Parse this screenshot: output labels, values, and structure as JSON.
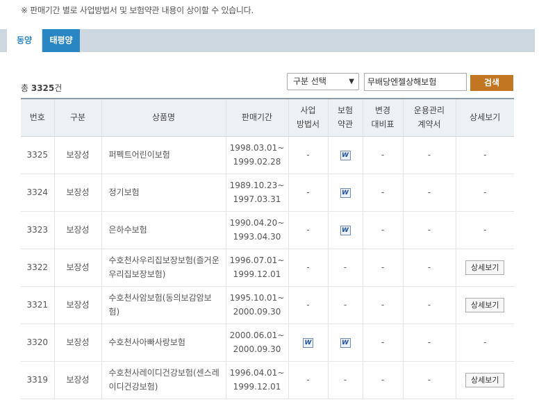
{
  "notice": "※ 판매기간 별로 사업방법서 및 보험약관 내용이 상이할 수 있습니다.",
  "tabs": [
    "동양",
    "태평양"
  ],
  "count": {
    "prefix": "총 ",
    "value": "3325",
    "suffix": "건"
  },
  "filter": {
    "select_value": "구분 선택",
    "search_value": "무배당엔젤상해보험",
    "search_button": "검색"
  },
  "table": {
    "headers": [
      "번호",
      "구분",
      "상품명",
      "판매기간",
      "사업\n방법서",
      "보험\n약관",
      "변경\n대비표",
      "운용관리\n계약서",
      "상세보기"
    ],
    "rows": [
      {
        "no": "3325",
        "type": "보장성",
        "name": "퍼펙트어린이보험",
        "period_from": "1998.03.01~",
        "period_to": "1999.02.28",
        "biz": "-",
        "terms": "W",
        "change": "-",
        "mgmt": "-",
        "detail": "-"
      },
      {
        "no": "3324",
        "type": "보장성",
        "name": "정기보험",
        "period_from": "1989.10.23~",
        "period_to": "1997.03.31",
        "biz": "-",
        "terms": "W",
        "change": "-",
        "mgmt": "-",
        "detail": "-"
      },
      {
        "no": "3323",
        "type": "보장성",
        "name": "은하수보험",
        "period_from": "1990.04.20~",
        "period_to": "1993.04.30",
        "biz": "-",
        "terms": "W",
        "change": "-",
        "mgmt": "-",
        "detail": "-"
      },
      {
        "no": "3322",
        "type": "보장성",
        "name": "수호천사우리집보장보험(즐거운우리집보장보험)",
        "period_from": "1996.07.01~",
        "period_to": "1999.12.01",
        "biz": "-",
        "terms": "-",
        "change": "-",
        "mgmt": "-",
        "detail": "상세보기"
      },
      {
        "no": "3321",
        "type": "보장성",
        "name": "수호천사암보험(동의보감암보험)",
        "period_from": "1995.10.01~",
        "period_to": "2000.09.30",
        "biz": "-",
        "terms": "-",
        "change": "-",
        "mgmt": "-",
        "detail": "상세보기"
      },
      {
        "no": "3320",
        "type": "보장성",
        "name": "수호천사아빠사랑보험",
        "period_from": "2000.06.01~",
        "period_to": "2000.09.30",
        "biz": "W",
        "terms": "W",
        "change": "-",
        "mgmt": "-",
        "detail": "-"
      },
      {
        "no": "3319",
        "type": "보장성",
        "name": "수호천사레이디건강보험(센스레이디건강보험)",
        "period_from": "1996.04.01~",
        "period_to": "1999.12.01",
        "biz": "-",
        "terms": "-",
        "change": "-",
        "mgmt": "-",
        "detail": "상세보기"
      }
    ]
  },
  "icons": {
    "word_doc": "word-file-icon",
    "select_chevron": "chevron-down-icon"
  }
}
